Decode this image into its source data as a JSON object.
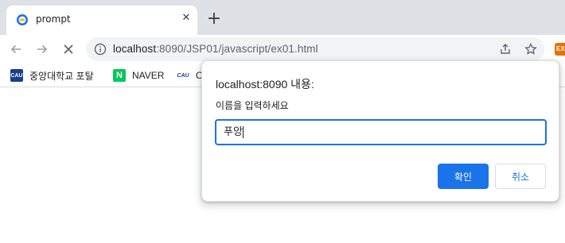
{
  "tab": {
    "title": "prompt"
  },
  "omnibox": {
    "url_host": "localhost",
    "url_path": ":8090/JSP01/javascript/ex01.html"
  },
  "extension": {
    "label": "EX"
  },
  "bookmarks": [
    {
      "icon": "CAU",
      "label": "중앙대학교 포탈"
    },
    {
      "icon": "N",
      "label": "NAVER"
    },
    {
      "icon": "CAU",
      "label": "CA"
    }
  ],
  "dialog": {
    "title": "localhost:8090 내용:",
    "message": "이름을 입력하세요",
    "input_value": "푸앙",
    "ok_label": "확인",
    "cancel_label": "취소"
  },
  "colors": {
    "accent": "#1a73e8",
    "tabstrip": "#dee1e6",
    "naver": "#03c75a",
    "cau": "#1b3d8f"
  }
}
